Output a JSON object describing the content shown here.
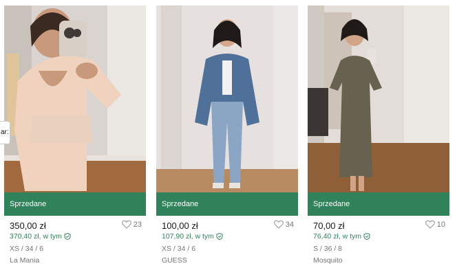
{
  "tooltip": {
    "text": "ar:"
  },
  "items": [
    {
      "status": "Sprzedane",
      "price": "350,00 zł",
      "price_with_protection": "370,40 zł, w tym",
      "details": "XS / 34 / 6",
      "brand": "La Mania",
      "favorites": "23"
    },
    {
      "status": "Sprzedane",
      "price": "100,00 zł",
      "price_with_protection": "107,90 zł, w tym",
      "details": "XS / 34 / 6",
      "brand": "GUESS",
      "favorites": "34"
    },
    {
      "status": "Sprzedane",
      "price": "70,00 zł",
      "price_with_protection": "76,40 zł, w tym",
      "details": "S / 36 / 8",
      "brand": "Mosquito",
      "favorites": "10"
    }
  ],
  "colors": {
    "sold_banner": "#2f8259",
    "protection_text": "#2f8259",
    "muted_text": "#757575"
  }
}
